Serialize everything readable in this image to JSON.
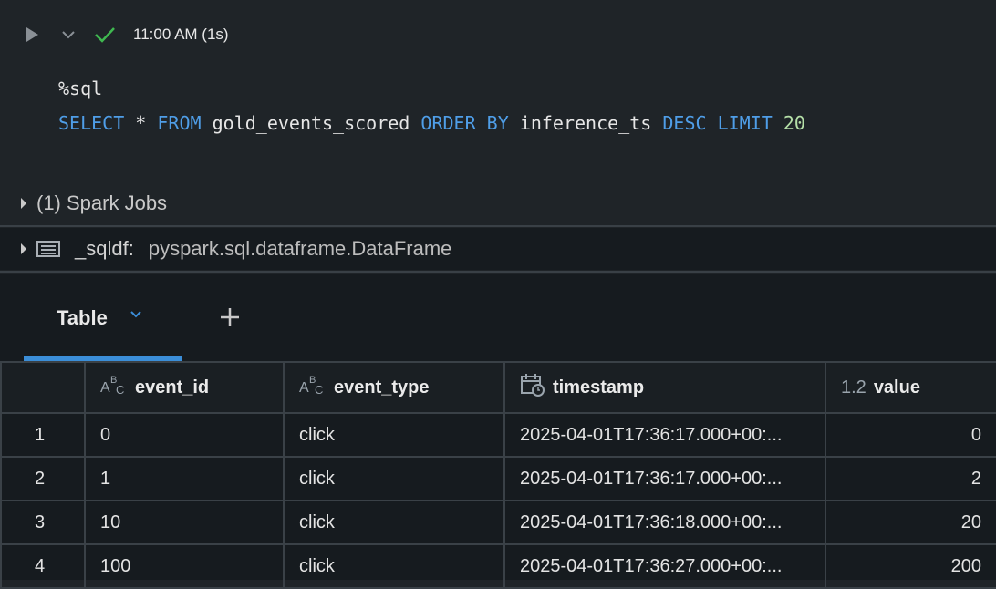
{
  "toolbar": {
    "run_status": "11:00 AM (1s)"
  },
  "code": {
    "line1": "%sql",
    "line2": {
      "select": "SELECT",
      "star": "*",
      "from": "FROM",
      "table": "gold_events_scored",
      "order": "ORDER",
      "by": "BY",
      "column": "inference_ts",
      "desc": "DESC",
      "limit": "LIMIT",
      "limit_value": "20"
    }
  },
  "spark_jobs": {
    "label": "(1) Spark Jobs"
  },
  "dataframe": {
    "name": "_sqldf:",
    "type": "pyspark.sql.dataframe.DataFrame"
  },
  "results": {
    "tab_label": "Table",
    "columns": [
      {
        "type_icon": "string-type-icon",
        "type_glyph": "ABC",
        "name": "event_id"
      },
      {
        "type_icon": "string-type-icon",
        "type_glyph": "ABC",
        "name": "event_type"
      },
      {
        "type_icon": "timestamp-type-icon",
        "type_glyph": "",
        "name": "timestamp"
      },
      {
        "type_icon": "decimal-type-icon",
        "type_glyph": "1.2",
        "name": "value"
      }
    ],
    "rows": [
      {
        "n": "1",
        "event_id": "0",
        "event_type": "click",
        "timestamp": "2025-04-01T17:36:17.000+00:...",
        "value": "0"
      },
      {
        "n": "2",
        "event_id": "1",
        "event_type": "click",
        "timestamp": "2025-04-01T17:36:17.000+00:...",
        "value": "2"
      },
      {
        "n": "3",
        "event_id": "10",
        "event_type": "click",
        "timestamp": "2025-04-01T17:36:18.000+00:...",
        "value": "20"
      },
      {
        "n": "4",
        "event_id": "100",
        "event_type": "click",
        "timestamp": "2025-04-01T17:36:27.000+00:...",
        "value": "200"
      }
    ]
  }
}
